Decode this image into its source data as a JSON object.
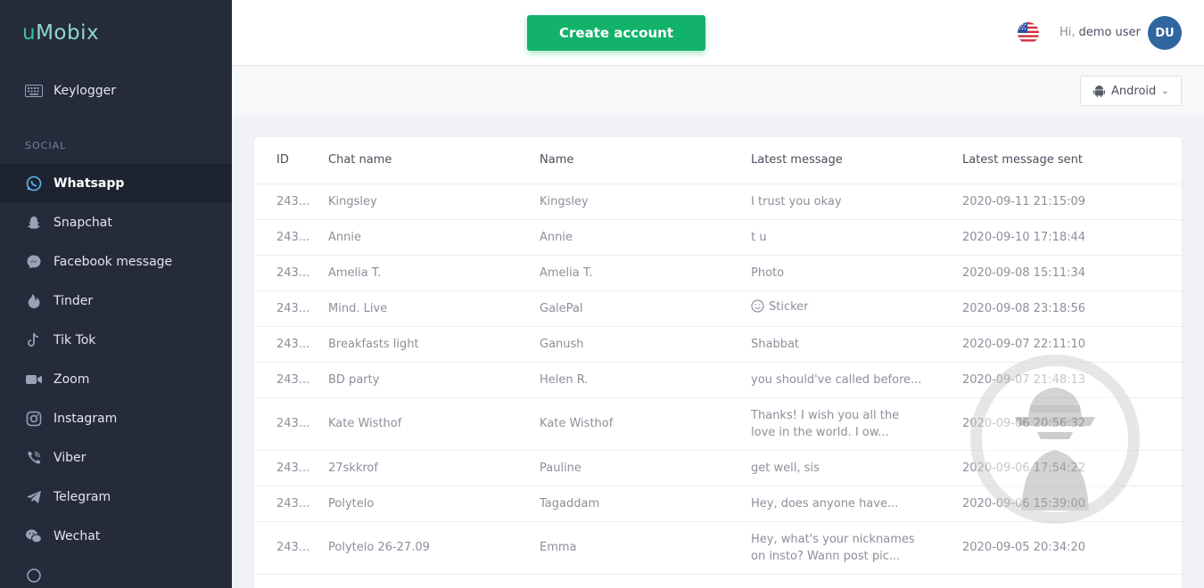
{
  "app": {
    "logo_first": "u",
    "logo_rest": "Mobix"
  },
  "sidebar": {
    "top_item": {
      "label": "Keylogger",
      "icon": "keyboard-icon"
    },
    "section_label": "SOCIAL",
    "items": [
      {
        "label": "Whatsapp",
        "icon": "whatsapp-icon",
        "active": true
      },
      {
        "label": "Snapchat",
        "icon": "snapchat-icon"
      },
      {
        "label": "Facebook message",
        "icon": "messenger-icon"
      },
      {
        "label": "Tinder",
        "icon": "tinder-icon"
      },
      {
        "label": "Tik Tok",
        "icon": "tiktok-icon"
      },
      {
        "label": "Zoom",
        "icon": "zoom-icon"
      },
      {
        "label": "Instagram",
        "icon": "instagram-icon"
      },
      {
        "label": "Viber",
        "icon": "viber-icon"
      },
      {
        "label": "Telegram",
        "icon": "telegram-icon"
      },
      {
        "label": "Wechat",
        "icon": "wechat-icon"
      }
    ]
  },
  "header": {
    "create_button": "Create account",
    "greeting": "Hi,",
    "username": "demo user",
    "avatar_initials": "DU",
    "flag_icon": "us-flag-icon"
  },
  "toolbar": {
    "os_value": "Android",
    "os_icon": "android-icon"
  },
  "table": {
    "headers": [
      "ID",
      "Chat name",
      "Name",
      "Latest message",
      "Latest message sent"
    ],
    "rows": [
      [
        "243...",
        "Kingsley",
        "Kingsley",
        "I trust you okay",
        "2020-09-11 21:15:09"
      ],
      [
        "243...",
        "Annie",
        "Annie",
        "t u",
        "2020-09-10 17:18:44"
      ],
      [
        "243...",
        "Amelia T.",
        "Amelia T.",
        "Photo",
        "2020-09-08 15:11:34"
      ],
      [
        "243...",
        "Mind. Live",
        "GalePal",
        "Sticker",
        "2020-09-08 23:18:56"
      ],
      [
        "243...",
        "Breakfasts light",
        "Ganush",
        "Shabbat",
        "2020-09-07 22:11:10"
      ],
      [
        "243...",
        "BD party",
        "Helen R.",
        "you should've called before...",
        "2020-09-07 21:48:13"
      ],
      [
        "243...",
        "Kate Wisthof",
        "Kate Wisthof",
        "Thanks! I wish you all the love in the world. I ow...",
        "2020-09-06 20:56:32"
      ],
      [
        "243...",
        "27skkrof",
        "Pauline",
        "get well, sis",
        "2020-09-06 17:54:22"
      ],
      [
        "243...",
        "Polytelo",
        "Tagaddam",
        "Hey, does anyone have...",
        "2020-09-06 15:39:00"
      ],
      [
        "243...",
        "Polytelo 26-27.09",
        "Emma",
        "Hey, what's your nicknames on insto? Wann post pic...",
        "2020-09-05 20:34:20"
      ]
    ]
  },
  "colors": {
    "sidebar_bg": "#252b3b",
    "accent_green": "#13b26b",
    "logo_teal": "#35c0a5",
    "avatar_blue": "#2f66a0"
  }
}
